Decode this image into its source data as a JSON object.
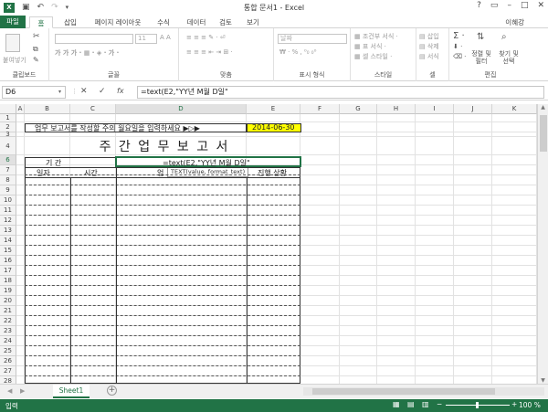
{
  "window": {
    "title": "통합 문서1 - Excel",
    "user": "이혜강"
  },
  "tabs": [
    "파일",
    "홈",
    "삽입",
    "페이지 레이아웃",
    "수식",
    "데이터",
    "검토",
    "보기"
  ],
  "ribbon": {
    "clipboard": {
      "label": "클립보드",
      "paste": "붙여넣기"
    },
    "font": {
      "label": "글꼴",
      "size": "11"
    },
    "alignment": {
      "label": "맞춤"
    },
    "number": {
      "label": "표시 형식",
      "format": "날짜"
    },
    "styles": {
      "label": "스타일",
      "conditional": "조건부 서식",
      "table": "표 서식",
      "cell": "셀 스타일"
    },
    "cells": {
      "label": "셀",
      "insert": "삽입",
      "delete": "삭제",
      "format": "서식"
    },
    "editing": {
      "label": "편집",
      "sort": "정렬 및 필터",
      "find": "찾기 및 선택"
    }
  },
  "formula_bar": {
    "name_box": "D6",
    "formula": "=text(E2,\"YY년 M월 D일\""
  },
  "columns": [
    "A",
    "B",
    "C",
    "D",
    "E",
    "F",
    "G",
    "H",
    "I",
    "J",
    "K"
  ],
  "rows": [
    "1",
    "2",
    "3",
    "4",
    "6",
    "7",
    "8",
    "9",
    "10",
    "11",
    "12",
    "13",
    "14",
    "15",
    "16",
    "17",
    "18",
    "19",
    "20",
    "21",
    "22",
    "23",
    "24",
    "25",
    "26",
    "27",
    "28"
  ],
  "cells": {
    "b2": "업무 보고서를 작성할 주의 월요일을 입력하세요 ▶▷▶",
    "e2": "2014-06-30",
    "title": "주 간 업 무 보 고 서",
    "period_label": "기    간",
    "d6_edit": "=text(E2,\"YY년 M월 D일\"",
    "tooltip": "TEXT(value, format_text)",
    "h_date": "일자",
    "h_time": "시간",
    "h_work": "업",
    "h_status": "진행 상황"
  },
  "sheet": {
    "tab": "Sheet1"
  },
  "status": {
    "mode": "입력",
    "zoom": "100 %"
  },
  "colors": {
    "accent": "#217346",
    "highlight": "#ffff00"
  }
}
